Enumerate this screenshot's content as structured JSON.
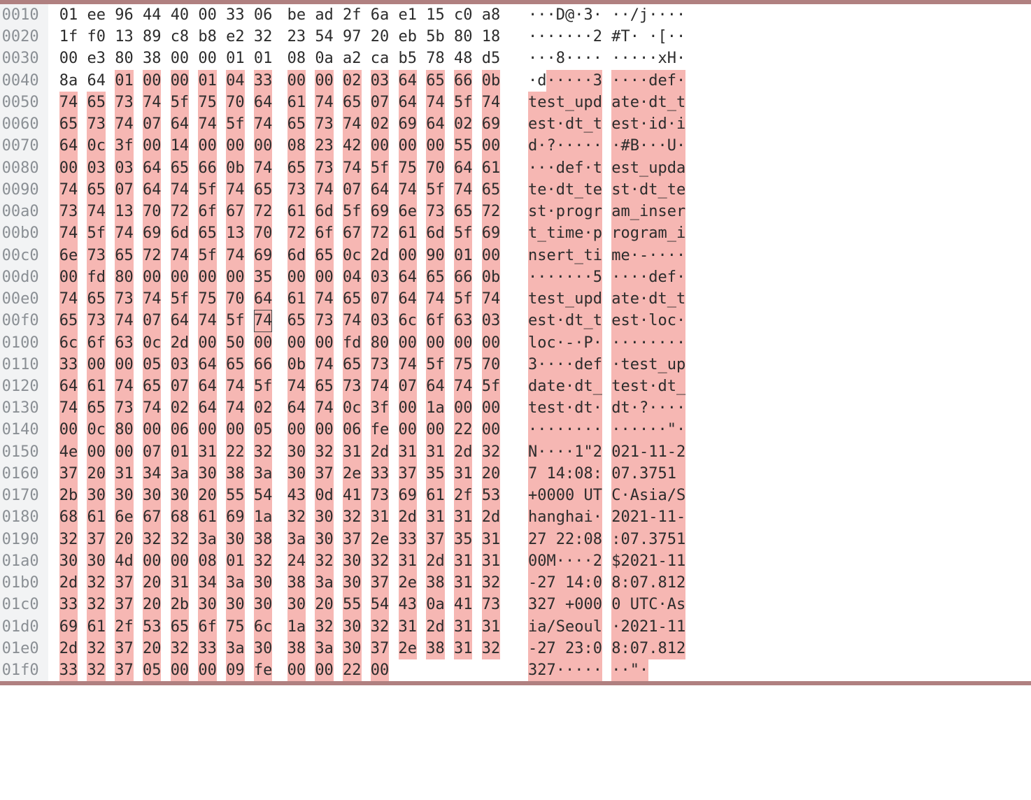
{
  "highlight_color": "#f6b7b3",
  "cursor": {
    "row": 15,
    "col": 7
  },
  "rows": [
    {
      "offset": "0010",
      "bytes": [
        "01",
        "ee",
        "96",
        "44",
        "40",
        "00",
        "33",
        "06",
        "be",
        "ad",
        "2f",
        "6a",
        "e1",
        "15",
        "c0",
        "a8"
      ],
      "ascii": [
        "·",
        "·",
        "·",
        "D",
        "@",
        "·",
        "3",
        "·",
        "·",
        "·",
        "/",
        "j",
        "·",
        "·",
        "·",
        "·"
      ],
      "hl_start": null,
      "hl_end": null
    },
    {
      "offset": "0020",
      "bytes": [
        "1f",
        "f0",
        "13",
        "89",
        "c8",
        "b8",
        "e2",
        "32",
        "23",
        "54",
        "97",
        "20",
        "eb",
        "5b",
        "80",
        "18"
      ],
      "ascii": [
        "·",
        "·",
        "·",
        "·",
        "·",
        "·",
        "·",
        "2",
        "#",
        "T",
        "·",
        " ",
        "·",
        "[",
        "·",
        "·"
      ],
      "hl_start": null,
      "hl_end": null
    },
    {
      "offset": "0030",
      "bytes": [
        "00",
        "e3",
        "80",
        "38",
        "00",
        "00",
        "01",
        "01",
        "08",
        "0a",
        "a2",
        "ca",
        "b5",
        "78",
        "48",
        "d5"
      ],
      "ascii": [
        "·",
        "·",
        "·",
        "8",
        "·",
        "·",
        "·",
        "·",
        "·",
        "·",
        "·",
        "·",
        "·",
        "x",
        "H",
        "·"
      ],
      "hl_start": null,
      "hl_end": null
    },
    {
      "offset": "0040",
      "bytes": [
        "8a",
        "64",
        "01",
        "00",
        "00",
        "01",
        "04",
        "33",
        "00",
        "00",
        "02",
        "03",
        "64",
        "65",
        "66",
        "0b"
      ],
      "ascii": [
        "·",
        "d",
        "·",
        "·",
        "·",
        "·",
        "·",
        "3",
        "·",
        "·",
        "·",
        "·",
        "d",
        "e",
        "f",
        "·"
      ],
      "hl_start": 2,
      "hl_end": 16
    },
    {
      "offset": "0050",
      "bytes": [
        "74",
        "65",
        "73",
        "74",
        "5f",
        "75",
        "70",
        "64",
        "61",
        "74",
        "65",
        "07",
        "64",
        "74",
        "5f",
        "74"
      ],
      "ascii": [
        "t",
        "e",
        "s",
        "t",
        "_",
        "u",
        "p",
        "d",
        "a",
        "t",
        "e",
        "·",
        "d",
        "t",
        "_",
        "t"
      ],
      "hl_start": 0,
      "hl_end": 16
    },
    {
      "offset": "0060",
      "bytes": [
        "65",
        "73",
        "74",
        "07",
        "64",
        "74",
        "5f",
        "74",
        "65",
        "73",
        "74",
        "02",
        "69",
        "64",
        "02",
        "69"
      ],
      "ascii": [
        "e",
        "s",
        "t",
        "·",
        "d",
        "t",
        "_",
        "t",
        "e",
        "s",
        "t",
        "·",
        "i",
        "d",
        "·",
        "i"
      ],
      "hl_start": 0,
      "hl_end": 16
    },
    {
      "offset": "0070",
      "bytes": [
        "64",
        "0c",
        "3f",
        "00",
        "14",
        "00",
        "00",
        "00",
        "08",
        "23",
        "42",
        "00",
        "00",
        "00",
        "55",
        "00"
      ],
      "ascii": [
        "d",
        "·",
        "?",
        "·",
        "·",
        "·",
        "·",
        "·",
        "·",
        "#",
        "B",
        "·",
        "·",
        "·",
        "U",
        "·"
      ],
      "hl_start": 0,
      "hl_end": 16
    },
    {
      "offset": "0080",
      "bytes": [
        "00",
        "03",
        "03",
        "64",
        "65",
        "66",
        "0b",
        "74",
        "65",
        "73",
        "74",
        "5f",
        "75",
        "70",
        "64",
        "61"
      ],
      "ascii": [
        "·",
        "·",
        "·",
        "d",
        "e",
        "f",
        "·",
        "t",
        "e",
        "s",
        "t",
        "_",
        "u",
        "p",
        "d",
        "a"
      ],
      "hl_start": 0,
      "hl_end": 16
    },
    {
      "offset": "0090",
      "bytes": [
        "74",
        "65",
        "07",
        "64",
        "74",
        "5f",
        "74",
        "65",
        "73",
        "74",
        "07",
        "64",
        "74",
        "5f",
        "74",
        "65"
      ],
      "ascii": [
        "t",
        "e",
        "·",
        "d",
        "t",
        "_",
        "t",
        "e",
        "s",
        "t",
        "·",
        "d",
        "t",
        "_",
        "t",
        "e"
      ],
      "hl_start": 0,
      "hl_end": 16
    },
    {
      "offset": "00a0",
      "bytes": [
        "73",
        "74",
        "13",
        "70",
        "72",
        "6f",
        "67",
        "72",
        "61",
        "6d",
        "5f",
        "69",
        "6e",
        "73",
        "65",
        "72"
      ],
      "ascii": [
        "s",
        "t",
        "·",
        "p",
        "r",
        "o",
        "g",
        "r",
        "a",
        "m",
        "_",
        "i",
        "n",
        "s",
        "e",
        "r"
      ],
      "hl_start": 0,
      "hl_end": 16
    },
    {
      "offset": "00b0",
      "bytes": [
        "74",
        "5f",
        "74",
        "69",
        "6d",
        "65",
        "13",
        "70",
        "72",
        "6f",
        "67",
        "72",
        "61",
        "6d",
        "5f",
        "69"
      ],
      "ascii": [
        "t",
        "_",
        "t",
        "i",
        "m",
        "e",
        "·",
        "p",
        "r",
        "o",
        "g",
        "r",
        "a",
        "m",
        "_",
        "i"
      ],
      "hl_start": 0,
      "hl_end": 16
    },
    {
      "offset": "00c0",
      "bytes": [
        "6e",
        "73",
        "65",
        "72",
        "74",
        "5f",
        "74",
        "69",
        "6d",
        "65",
        "0c",
        "2d",
        "00",
        "90",
        "01",
        "00"
      ],
      "ascii": [
        "n",
        "s",
        "e",
        "r",
        "t",
        "_",
        "t",
        "i",
        "m",
        "e",
        "·",
        "-",
        "·",
        "·",
        "·",
        "·"
      ],
      "hl_start": 0,
      "hl_end": 16
    },
    {
      "offset": "00d0",
      "bytes": [
        "00",
        "fd",
        "80",
        "00",
        "00",
        "00",
        "00",
        "35",
        "00",
        "00",
        "04",
        "03",
        "64",
        "65",
        "66",
        "0b"
      ],
      "ascii": [
        "·",
        "·",
        "·",
        "·",
        "·",
        "·",
        "·",
        "5",
        "·",
        "·",
        "·",
        "·",
        "d",
        "e",
        "f",
        "·"
      ],
      "hl_start": 0,
      "hl_end": 16
    },
    {
      "offset": "00e0",
      "bytes": [
        "74",
        "65",
        "73",
        "74",
        "5f",
        "75",
        "70",
        "64",
        "61",
        "74",
        "65",
        "07",
        "64",
        "74",
        "5f",
        "74"
      ],
      "ascii": [
        "t",
        "e",
        "s",
        "t",
        "_",
        "u",
        "p",
        "d",
        "a",
        "t",
        "e",
        "·",
        "d",
        "t",
        "_",
        "t"
      ],
      "hl_start": 0,
      "hl_end": 16
    },
    {
      "offset": "00f0",
      "bytes": [
        "65",
        "73",
        "74",
        "07",
        "64",
        "74",
        "5f",
        "74",
        "65",
        "73",
        "74",
        "03",
        "6c",
        "6f",
        "63",
        "03"
      ],
      "ascii": [
        "e",
        "s",
        "t",
        "·",
        "d",
        "t",
        "_",
        "t",
        "e",
        "s",
        "t",
        "·",
        "l",
        "o",
        "c",
        "·"
      ],
      "hl_start": 0,
      "hl_end": 16
    },
    {
      "offset": "0100",
      "bytes": [
        "6c",
        "6f",
        "63",
        "0c",
        "2d",
        "00",
        "50",
        "00",
        "00",
        "00",
        "fd",
        "80",
        "00",
        "00",
        "00",
        "00"
      ],
      "ascii": [
        "l",
        "o",
        "c",
        "·",
        "-",
        "·",
        "P",
        "·",
        "·",
        "·",
        "·",
        "·",
        "·",
        "·",
        "·",
        "·"
      ],
      "hl_start": 0,
      "hl_end": 16
    },
    {
      "offset": "0110",
      "bytes": [
        "33",
        "00",
        "00",
        "05",
        "03",
        "64",
        "65",
        "66",
        "0b",
        "74",
        "65",
        "73",
        "74",
        "5f",
        "75",
        "70"
      ],
      "ascii": [
        "3",
        "·",
        "·",
        "·",
        "·",
        "d",
        "e",
        "f",
        "·",
        "t",
        "e",
        "s",
        "t",
        "_",
        "u",
        "p"
      ],
      "hl_start": 0,
      "hl_end": 16
    },
    {
      "offset": "0120",
      "bytes": [
        "64",
        "61",
        "74",
        "65",
        "07",
        "64",
        "74",
        "5f",
        "74",
        "65",
        "73",
        "74",
        "07",
        "64",
        "74",
        "5f"
      ],
      "ascii": [
        "d",
        "a",
        "t",
        "e",
        "·",
        "d",
        "t",
        "_",
        "t",
        "e",
        "s",
        "t",
        "·",
        "d",
        "t",
        "_"
      ],
      "hl_start": 0,
      "hl_end": 16
    },
    {
      "offset": "0130",
      "bytes": [
        "74",
        "65",
        "73",
        "74",
        "02",
        "64",
        "74",
        "02",
        "64",
        "74",
        "0c",
        "3f",
        "00",
        "1a",
        "00",
        "00"
      ],
      "ascii": [
        "t",
        "e",
        "s",
        "t",
        "·",
        "d",
        "t",
        "·",
        "d",
        "t",
        "·",
        "?",
        "·",
        "·",
        "·",
        "·"
      ],
      "hl_start": 0,
      "hl_end": 16
    },
    {
      "offset": "0140",
      "bytes": [
        "00",
        "0c",
        "80",
        "00",
        "06",
        "00",
        "00",
        "05",
        "00",
        "00",
        "06",
        "fe",
        "00",
        "00",
        "22",
        "00"
      ],
      "ascii": [
        "·",
        "·",
        "·",
        "·",
        "·",
        "·",
        "·",
        "·",
        "·",
        "·",
        "·",
        "·",
        "·",
        "·",
        "\"",
        "·"
      ],
      "hl_start": 0,
      "hl_end": 16
    },
    {
      "offset": "0150",
      "bytes": [
        "4e",
        "00",
        "00",
        "07",
        "01",
        "31",
        "22",
        "32",
        "30",
        "32",
        "31",
        "2d",
        "31",
        "31",
        "2d",
        "32"
      ],
      "ascii": [
        "N",
        "·",
        "·",
        "·",
        "·",
        "1",
        "\"",
        "2",
        "0",
        "2",
        "1",
        "-",
        "1",
        "1",
        "-",
        "2"
      ],
      "hl_start": 0,
      "hl_end": 16
    },
    {
      "offset": "0160",
      "bytes": [
        "37",
        "20",
        "31",
        "34",
        "3a",
        "30",
        "38",
        "3a",
        "30",
        "37",
        "2e",
        "33",
        "37",
        "35",
        "31",
        "20"
      ],
      "ascii": [
        "7",
        " ",
        "1",
        "4",
        ":",
        "0",
        "8",
        ":",
        "0",
        "7",
        ".",
        "3",
        "7",
        "5",
        "1",
        " "
      ],
      "hl_start": 0,
      "hl_end": 16
    },
    {
      "offset": "0170",
      "bytes": [
        "2b",
        "30",
        "30",
        "30",
        "30",
        "20",
        "55",
        "54",
        "43",
        "0d",
        "41",
        "73",
        "69",
        "61",
        "2f",
        "53"
      ],
      "ascii": [
        "+",
        "0",
        "0",
        "0",
        "0",
        " ",
        "U",
        "T",
        "C",
        "·",
        "A",
        "s",
        "i",
        "a",
        "/",
        "S"
      ],
      "hl_start": 0,
      "hl_end": 16
    },
    {
      "offset": "0180",
      "bytes": [
        "68",
        "61",
        "6e",
        "67",
        "68",
        "61",
        "69",
        "1a",
        "32",
        "30",
        "32",
        "31",
        "2d",
        "31",
        "31",
        "2d"
      ],
      "ascii": [
        "h",
        "a",
        "n",
        "g",
        "h",
        "a",
        "i",
        "·",
        "2",
        "0",
        "2",
        "1",
        "-",
        "1",
        "1",
        "-"
      ],
      "hl_start": 0,
      "hl_end": 16
    },
    {
      "offset": "0190",
      "bytes": [
        "32",
        "37",
        "20",
        "32",
        "32",
        "3a",
        "30",
        "38",
        "3a",
        "30",
        "37",
        "2e",
        "33",
        "37",
        "35",
        "31"
      ],
      "ascii": [
        "2",
        "7",
        " ",
        "2",
        "2",
        ":",
        "0",
        "8",
        ":",
        "0",
        "7",
        ".",
        "3",
        "7",
        "5",
        "1"
      ],
      "hl_start": 0,
      "hl_end": 16
    },
    {
      "offset": "01a0",
      "bytes": [
        "30",
        "30",
        "4d",
        "00",
        "00",
        "08",
        "01",
        "32",
        "24",
        "32",
        "30",
        "32",
        "31",
        "2d",
        "31",
        "31"
      ],
      "ascii": [
        "0",
        "0",
        "M",
        "·",
        "·",
        "·",
        "·",
        "2",
        "$",
        "2",
        "0",
        "2",
        "1",
        "-",
        "1",
        "1"
      ],
      "hl_start": 0,
      "hl_end": 16
    },
    {
      "offset": "01b0",
      "bytes": [
        "2d",
        "32",
        "37",
        "20",
        "31",
        "34",
        "3a",
        "30",
        "38",
        "3a",
        "30",
        "37",
        "2e",
        "38",
        "31",
        "32"
      ],
      "ascii": [
        "-",
        "2",
        "7",
        " ",
        "1",
        "4",
        ":",
        "0",
        "8",
        ":",
        "0",
        "7",
        ".",
        "8",
        "1",
        "2"
      ],
      "hl_start": 0,
      "hl_end": 16
    },
    {
      "offset": "01c0",
      "bytes": [
        "33",
        "32",
        "37",
        "20",
        "2b",
        "30",
        "30",
        "30",
        "30",
        "20",
        "55",
        "54",
        "43",
        "0a",
        "41",
        "73"
      ],
      "ascii": [
        "3",
        "2",
        "7",
        " ",
        "+",
        "0",
        "0",
        "0",
        "0",
        " ",
        "U",
        "T",
        "C",
        "·",
        "A",
        "s"
      ],
      "hl_start": 0,
      "hl_end": 16
    },
    {
      "offset": "01d0",
      "bytes": [
        "69",
        "61",
        "2f",
        "53",
        "65",
        "6f",
        "75",
        "6c",
        "1a",
        "32",
        "30",
        "32",
        "31",
        "2d",
        "31",
        "31"
      ],
      "ascii": [
        "i",
        "a",
        "/",
        "S",
        "e",
        "o",
        "u",
        "l",
        "·",
        "2",
        "0",
        "2",
        "1",
        "-",
        "1",
        "1"
      ],
      "hl_start": 0,
      "hl_end": 16
    },
    {
      "offset": "01e0",
      "bytes": [
        "2d",
        "32",
        "37",
        "20",
        "32",
        "33",
        "3a",
        "30",
        "38",
        "3a",
        "30",
        "37",
        "2e",
        "38",
        "31",
        "32"
      ],
      "ascii": [
        "-",
        "2",
        "7",
        " ",
        "2",
        "3",
        ":",
        "0",
        "8",
        ":",
        "0",
        "7",
        ".",
        "8",
        "1",
        "2"
      ],
      "hl_start": 0,
      "hl_end": 16
    },
    {
      "offset": "01f0",
      "bytes": [
        "33",
        "32",
        "37",
        "05",
        "00",
        "00",
        "09",
        "fe",
        "00",
        "00",
        "22",
        "00"
      ],
      "ascii": [
        "3",
        "2",
        "7",
        "·",
        "·",
        "·",
        "·",
        "·",
        "·",
        "·",
        "\"",
        "·"
      ],
      "hl_start": 0,
      "hl_end": 12
    }
  ]
}
